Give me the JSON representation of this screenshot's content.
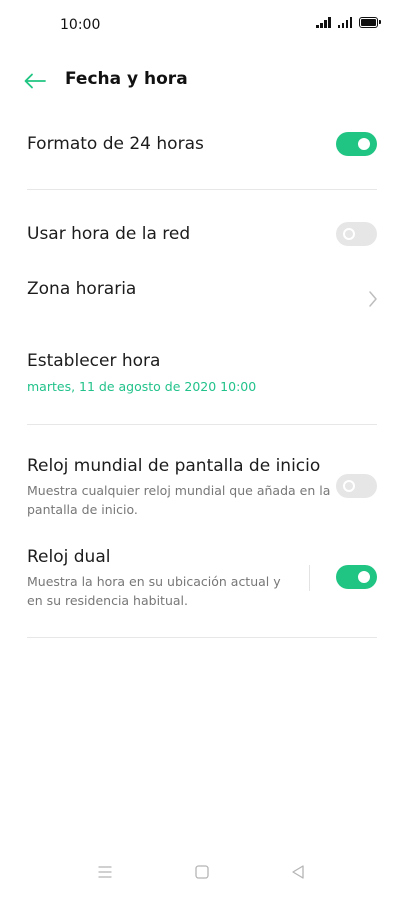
{
  "status_bar": {
    "time": "10:00"
  },
  "header": {
    "title": "Fecha y hora",
    "back_icon": "arrow-left-icon"
  },
  "settings": {
    "format_24h": {
      "label": "Formato de 24 horas",
      "enabled": true
    },
    "network_time": {
      "label": "Usar hora de la red",
      "enabled": false
    },
    "time_zone": {
      "label": "Zona horaria"
    },
    "set_time": {
      "label": "Establecer hora",
      "value": "martes, 11 de agosto de 2020  10:00"
    },
    "world_clock": {
      "label": "Reloj mundial de pantalla de inicio",
      "description_line1": "Muestra cualquier reloj mundial que añada en la",
      "description_line2": "pantalla de inicio.",
      "enabled": false
    },
    "dual_clock": {
      "label": "Reloj dual",
      "description_line1": "Muestra la hora en su ubicación actual y",
      "description_line2": "en su residencia habitual.",
      "enabled": true
    }
  },
  "colors": {
    "accent": "#20c583",
    "value_text": "#22c28a"
  },
  "nav_bar": {
    "icons": [
      "menu-icon",
      "home-square-icon",
      "back-triangle-icon"
    ]
  }
}
